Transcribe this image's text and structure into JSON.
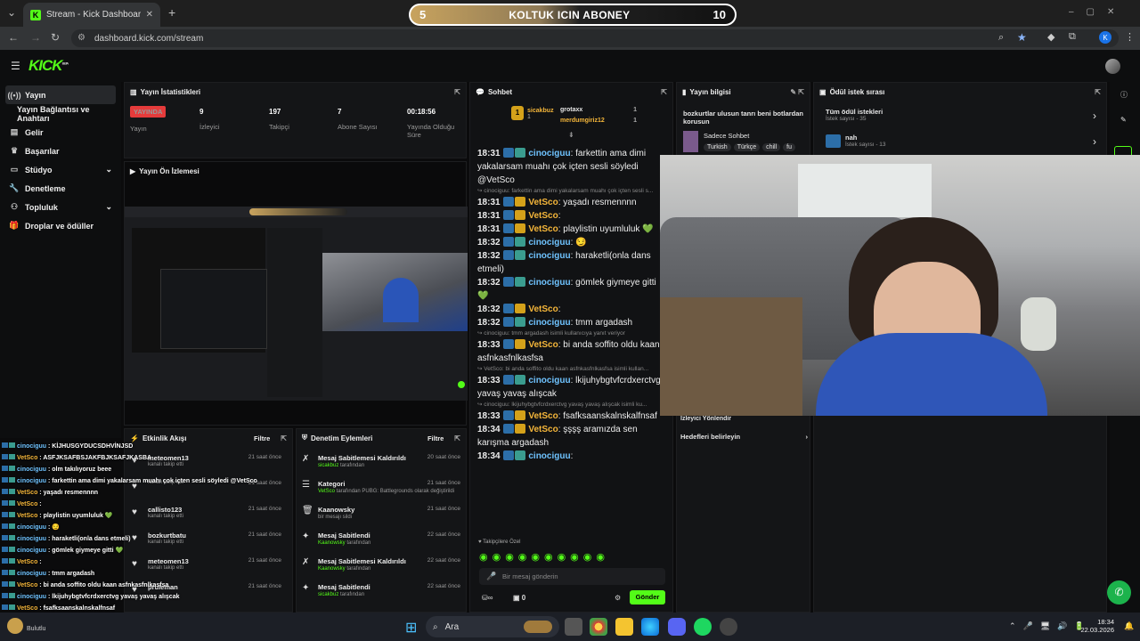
{
  "browser": {
    "tab_title": "Stream - Kick Dashboard",
    "url": "dashboard.kick.com/stream",
    "profile_initial": "K"
  },
  "sub_goal": {
    "left": "5",
    "label": "KOLTUK ICIN ABONEY",
    "right": "10"
  },
  "app": {
    "logo": "KICK",
    "logo_sup": "BETA"
  },
  "sidebar": {
    "items": [
      {
        "label": "Yayın",
        "icon": "broadcast-icon",
        "active": true
      },
      {
        "label": "Yayın Bağlantısı ve Anahtarı",
        "icon": "",
        "active": false
      },
      {
        "label": "Gelir",
        "icon": "money-icon"
      },
      {
        "label": "Başarılar",
        "icon": "trophy-icon"
      },
      {
        "label": "Stüdyo",
        "icon": "studio-icon",
        "chevron": true
      },
      {
        "label": "Denetleme",
        "icon": "wrench-icon"
      },
      {
        "label": "Topluluk",
        "icon": "community-icon",
        "chevron": true
      },
      {
        "label": "Droplar ve ödüller",
        "icon": "gift-icon"
      }
    ]
  },
  "stats": {
    "title": "Yayın İstatistikleri",
    "live_badge": "YAYINDA",
    "live_label": "Yayın",
    "viewers": "9",
    "viewers_label": "İzleyici",
    "followers": "197",
    "followers_label": "Takipçi",
    "subs": "7",
    "subs_label": "Abone Sayısı",
    "uptime": "00:18:56",
    "uptime_label": "Yayında Olduğu Süre"
  },
  "preview": {
    "title": "Yayın Ön İzlemesi"
  },
  "chat": {
    "title": "Sohbet",
    "top_gifters": [
      {
        "rank": "1",
        "name": "sicakbuz",
        "count": "1"
      },
      {
        "rank": "2",
        "name": "grotaxx",
        "count": "1"
      },
      {
        "rank": "3",
        "name": "merdumgiriz12",
        "count": "1"
      }
    ],
    "lines": [
      {
        "time": "18:31",
        "user": "cinociguu",
        "ucls": "u1",
        "msg": ": farkettin ama dimi yakalarsam muahı çok içten sesli söyledi @VetSco"
      },
      {
        "reply": "cinociguu: farkettin ama dimi yakalarsam muahı çok içten sesli s..."
      },
      {
        "time": "18:31",
        "user": "VetSco",
        "ucls": "u2",
        "msg": ": yaşadı resmennnn"
      },
      {
        "time": "18:31",
        "user": "VetSco",
        "ucls": "u2",
        "msg": ":"
      },
      {
        "time": "18:31",
        "user": "VetSco",
        "ucls": "u2",
        "msg": ": playlistin uyumluluk 💚"
      },
      {
        "time": "18:32",
        "user": "cinociguu",
        "ucls": "u1",
        "msg": ": 😏"
      },
      {
        "time": "18:32",
        "user": "cinociguu",
        "ucls": "u1",
        "msg": ": haraketli(onla dans etmeli)"
      },
      {
        "time": "18:32",
        "user": "cinociguu",
        "ucls": "u1",
        "msg": ": gömlek giymeye gitti 💚"
      },
      {
        "time": "18:32",
        "user": "VetSco",
        "ucls": "u2",
        "msg": ":"
      },
      {
        "time": "18:32",
        "user": "cinociguu",
        "ucls": "u1",
        "msg": ": tmm argadash"
      },
      {
        "reply": "cinociguu: tmm argadash isimli kullanıcıya yanıt veriyor"
      },
      {
        "time": "18:33",
        "user": "VetSco",
        "ucls": "u2",
        "msg": ": bi anda soffito oldu kaan asfnkasfnlkasfsa"
      },
      {
        "reply": "VetSco: bi anda soffito oldu kaan asfnkasfnlkasfsa isimli kullan..."
      },
      {
        "time": "18:33",
        "user": "cinociguu",
        "ucls": "u1",
        "msg": ": lkijuhybgtvfcrdxerctvg yavaş yavaş alışcak"
      },
      {
        "reply": "cinociguu: lkijuhybgtvfcrdxerctvg yavaş yavaş alışcak isimli ku..."
      },
      {
        "time": "18:33",
        "user": "VetSco",
        "ucls": "u2",
        "msg": ": fsafksaanskalnskalfnsaf"
      },
      {
        "time": "18:34",
        "user": "VetSco",
        "ucls": "u2",
        "msg": ": şşşş aramızda sen karışma argadash"
      },
      {
        "time": "18:34",
        "user": "cinociguu",
        "ucls": "u1",
        "msg": ":"
      }
    ],
    "emote_label": "Takipçilere Özel",
    "input_placeholder": "Bir mesaj gönderin",
    "points": "0",
    "send": "Gönder"
  },
  "info": {
    "title": "Yayın bilgisi",
    "stream_title": "bozkurtlar ulusun tanrı beni botlardan korusun",
    "category": "Sadece Sohbet",
    "tags": [
      "Turkish",
      "Türkçe",
      "chill",
      "fu"
    ],
    "raid_label": "İzleyici Yönlendir",
    "goals_label": "Hedefleri belirleyin"
  },
  "rewards": {
    "title": "Ödül istek sırası",
    "items": [
      {
        "name": "Tüm ödül istekleri",
        "sub": "İstek sayısı - 35"
      },
      {
        "name": "nah",
        "sub": "İstek sayısı - 13"
      }
    ]
  },
  "activity": {
    "title": "Etkinlik Akışı",
    "filter": "Filtre",
    "rows": [
      {
        "name": "meteomen13",
        "sub": "kanalı takip etti",
        "time": "21 saat önce"
      },
      {
        "name": "",
        "sub": "kanalı takip etti",
        "time": "21 saat önce"
      },
      {
        "name": "callisto123",
        "sub": "kanalı takip etti",
        "time": "21 saat önce"
      },
      {
        "name": "bozkurtbatu",
        "sub": "kanalı takip etti",
        "time": "21 saat önce"
      },
      {
        "name": "meteomen13",
        "sub": "kanalı takip etti",
        "time": "21 saat önce"
      },
      {
        "name": "pruleman",
        "sub": "",
        "time": "21 saat önce"
      }
    ]
  },
  "modlog": {
    "title": "Denetim Eylemleri",
    "filter": "Filtre",
    "rows": [
      {
        "name": "Mesaj Sabitlemesi Kaldırıldı",
        "actor": "sicakbuz",
        "rest": " tarafından",
        "time": "20 saat önce"
      },
      {
        "name": "Kategori",
        "actor": "VetSco",
        "rest": " tarafından PUBG: Battlegrounds olarak değiştirildi",
        "time": "21 saat önce"
      },
      {
        "name": "Kaanowsky",
        "actor": "",
        "rest": "bir mesajı sildi",
        "time": "21 saat önce"
      },
      {
        "name": "Mesaj Sabitlendi",
        "actor": "Kaanowsky",
        "rest": " tarafından",
        "time": "22 saat önce"
      },
      {
        "name": "Mesaj Sabitlemesi Kaldırıldı",
        "actor": "Kaanowsky",
        "rest": " tarafından",
        "time": "22 saat önce"
      },
      {
        "name": "Mesaj Sabitlendi",
        "actor": "sicakbuz",
        "rest": " tarafından",
        "time": "22 saat önce"
      }
    ]
  },
  "overlay_chat": [
    {
      "u": "cinociguu",
      "c": "u1",
      "m": " : KİJHUSGYDUCSDHVİNJSD"
    },
    {
      "u": "VetSco",
      "c": "u2",
      "m": " : ASFJKSAFBSJAKFBJKSAFJKASBA"
    },
    {
      "u": "cinociguu",
      "c": "u1",
      "m": " : olm takılıyoruz beee"
    },
    {
      "u": "cinociguu",
      "c": "u1",
      "m": " : farkettin ama dimi yakalarsam muahı çok içten sesli söyledi @VetSco"
    },
    {
      "u": "VetSco",
      "c": "u2",
      "m": " : yaşadı resmennnn"
    },
    {
      "u": "VetSco",
      "c": "u2",
      "m": " :"
    },
    {
      "u": "VetSco",
      "c": "u2",
      "m": " : playlistin uyumluluk 💚"
    },
    {
      "u": "cinociguu",
      "c": "u1",
      "m": " : 😏"
    },
    {
      "u": "cinociguu",
      "c": "u1",
      "m": " : haraketli(onla dans etmeli)"
    },
    {
      "u": "cinociguu",
      "c": "u1",
      "m": " : gömlek giymeye gitti 💚"
    },
    {
      "u": "VetSco",
      "c": "u2",
      "m": " :"
    },
    {
      "u": "cinociguu",
      "c": "u1",
      "m": " : tmm argadash"
    },
    {
      "u": "VetSco",
      "c": "u2",
      "m": " : bi anda soffito oldu kaan asfnkasfnlkasfsa"
    },
    {
      "u": "cinociguu",
      "c": "u1",
      "m": " : lkijuhybgtvfcrdxerctvg yavaş yavaş alışcak"
    },
    {
      "u": "VetSco",
      "c": "u2",
      "m": " : fsafksaanskalnskalfnsaf"
    },
    {
      "u": "VetSco",
      "c": "u2",
      "m": " : şşşş aramızda sen karışma argadash"
    },
    {
      "u": "cinociguu",
      "c": "u1",
      "m": " :"
    }
  ],
  "taskbar": {
    "search": "Ara",
    "time": "18:34",
    "date": "22.03.2026",
    "weather_label": "Bulutlu"
  },
  "colors": {
    "kick_green": "#53fc18",
    "live_red": "#e53b3b",
    "user_blue": "#6fc3ff",
    "user_gold": "#f5b63a"
  }
}
